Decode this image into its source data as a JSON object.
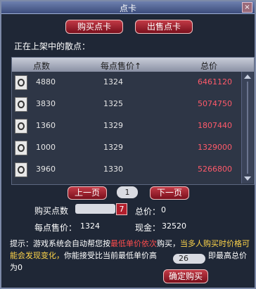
{
  "window": {
    "title": "点卡",
    "close_glyph": "×"
  },
  "top_tabs": {
    "buy_label": "购买点卡",
    "sell_label": "出售点卡"
  },
  "listing_caption": "正在上架中的散点：",
  "table": {
    "headers": {
      "amount": "点数",
      "unit_price": "每点售价↑",
      "total": "总价"
    },
    "rows": [
      {
        "amount": "4880",
        "unit_price": "1324",
        "total": "6461120"
      },
      {
        "amount": "3830",
        "unit_price": "1325",
        "total": "5074750"
      },
      {
        "amount": "1360",
        "unit_price": "1329",
        "total": "1807440"
      },
      {
        "amount": "1000",
        "unit_price": "1329",
        "total": "1329000"
      },
      {
        "amount": "3960",
        "unit_price": "1330",
        "total": "5266800"
      }
    ],
    "row_icon": "point-card-icon"
  },
  "pager": {
    "prev_label": "上一页",
    "page": "1",
    "next_label": "下一页"
  },
  "purchase": {
    "qty_label": "购买点数",
    "qty_value": "",
    "qty_button_glyph": "7",
    "total_label": "总价：",
    "total_value": "0",
    "unit_label": "每点售价：",
    "unit_value": "1324",
    "cash_label": "现金：",
    "cash_value": "32520"
  },
  "hint": {
    "prefix": "提示：游戏系统会自动帮您按",
    "red": "最低单价依次",
    "mid": "购买，",
    "yellow": "当多人购买时价格可能会发现变化，",
    "tail": "你能接受比当前最低单价高",
    "input_value": "26",
    "end": "，即最高总价为",
    "max_total": "0"
  },
  "confirm_label": "确定购买",
  "colors": {
    "accent_red": "#b11e2c",
    "total_text": "#ff5a6a",
    "warning_yellow": "#ffd54a"
  }
}
